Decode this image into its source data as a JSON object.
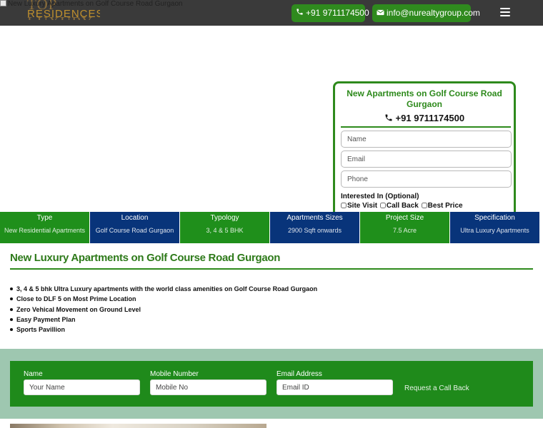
{
  "header": {
    "logo_top": "TOP LUXURY",
    "logo_bottom": "RESIDENCES",
    "hero_alt": "New Luxury Apartments on Golf Course Road Gurgaon",
    "phone": "+91 9711174500",
    "email": "info@nurealtygroup.com",
    "icons": {
      "phone": "phone-icon",
      "email": "envelope-icon",
      "menu": "hamburger-menu-icon"
    },
    "accent_color": "#2f8a1e",
    "bar_color": "#3a3a3a"
  },
  "enquiry_form": {
    "title": "New Apartments on Golf Course Road Gurgaon",
    "phone": "+91 9711174500",
    "name_placeholder": "Name",
    "email_placeholder": "Email",
    "phone_placeholder": "Phone",
    "interest_label": "Interested In (Optional)",
    "options": [
      "Site Visit",
      "Call Back",
      "Best Price"
    ]
  },
  "info_strip": [
    {
      "label": "Type",
      "value": "New Residential Apartments",
      "color": "#1f8f1b"
    },
    {
      "label": "Location",
      "value": "Golf Course Road Gurgaon",
      "color": "#08347a"
    },
    {
      "label": "Typology",
      "value": "3, 4 & 5 BHK",
      "color": "#1f8f1b"
    },
    {
      "label": "Apartments Sizes",
      "value": "2900 Sqft onwards",
      "color": "#08347a"
    },
    {
      "label": "Project Size",
      "value": "7.5 Acre",
      "color": "#1f8f1b"
    },
    {
      "label": "Specification",
      "value": "Ultra Luxury Apartments",
      "color": "#08347a"
    }
  ],
  "main": {
    "title": "New Luxury Apartments on Golf Course Road Gurgaon",
    "features": [
      "3, 4 & 5 bhk Ultra Luxury apartments with the world class amenities on Golf Course Road Gurgaon",
      "Close to DLF 5 on Most Prime Location",
      "Zero Vehical Movement on Ground Level",
      "Easy Payment Plan",
      "Sports Pavillion"
    ]
  },
  "callback": {
    "name_label": "Name",
    "name_placeholder": "Your Name",
    "mobile_label": "Mobile Number",
    "mobile_placeholder": "Mobile No",
    "email_label": "Email Address",
    "email_placeholder": "Email ID",
    "button": "Request a Call Back"
  }
}
